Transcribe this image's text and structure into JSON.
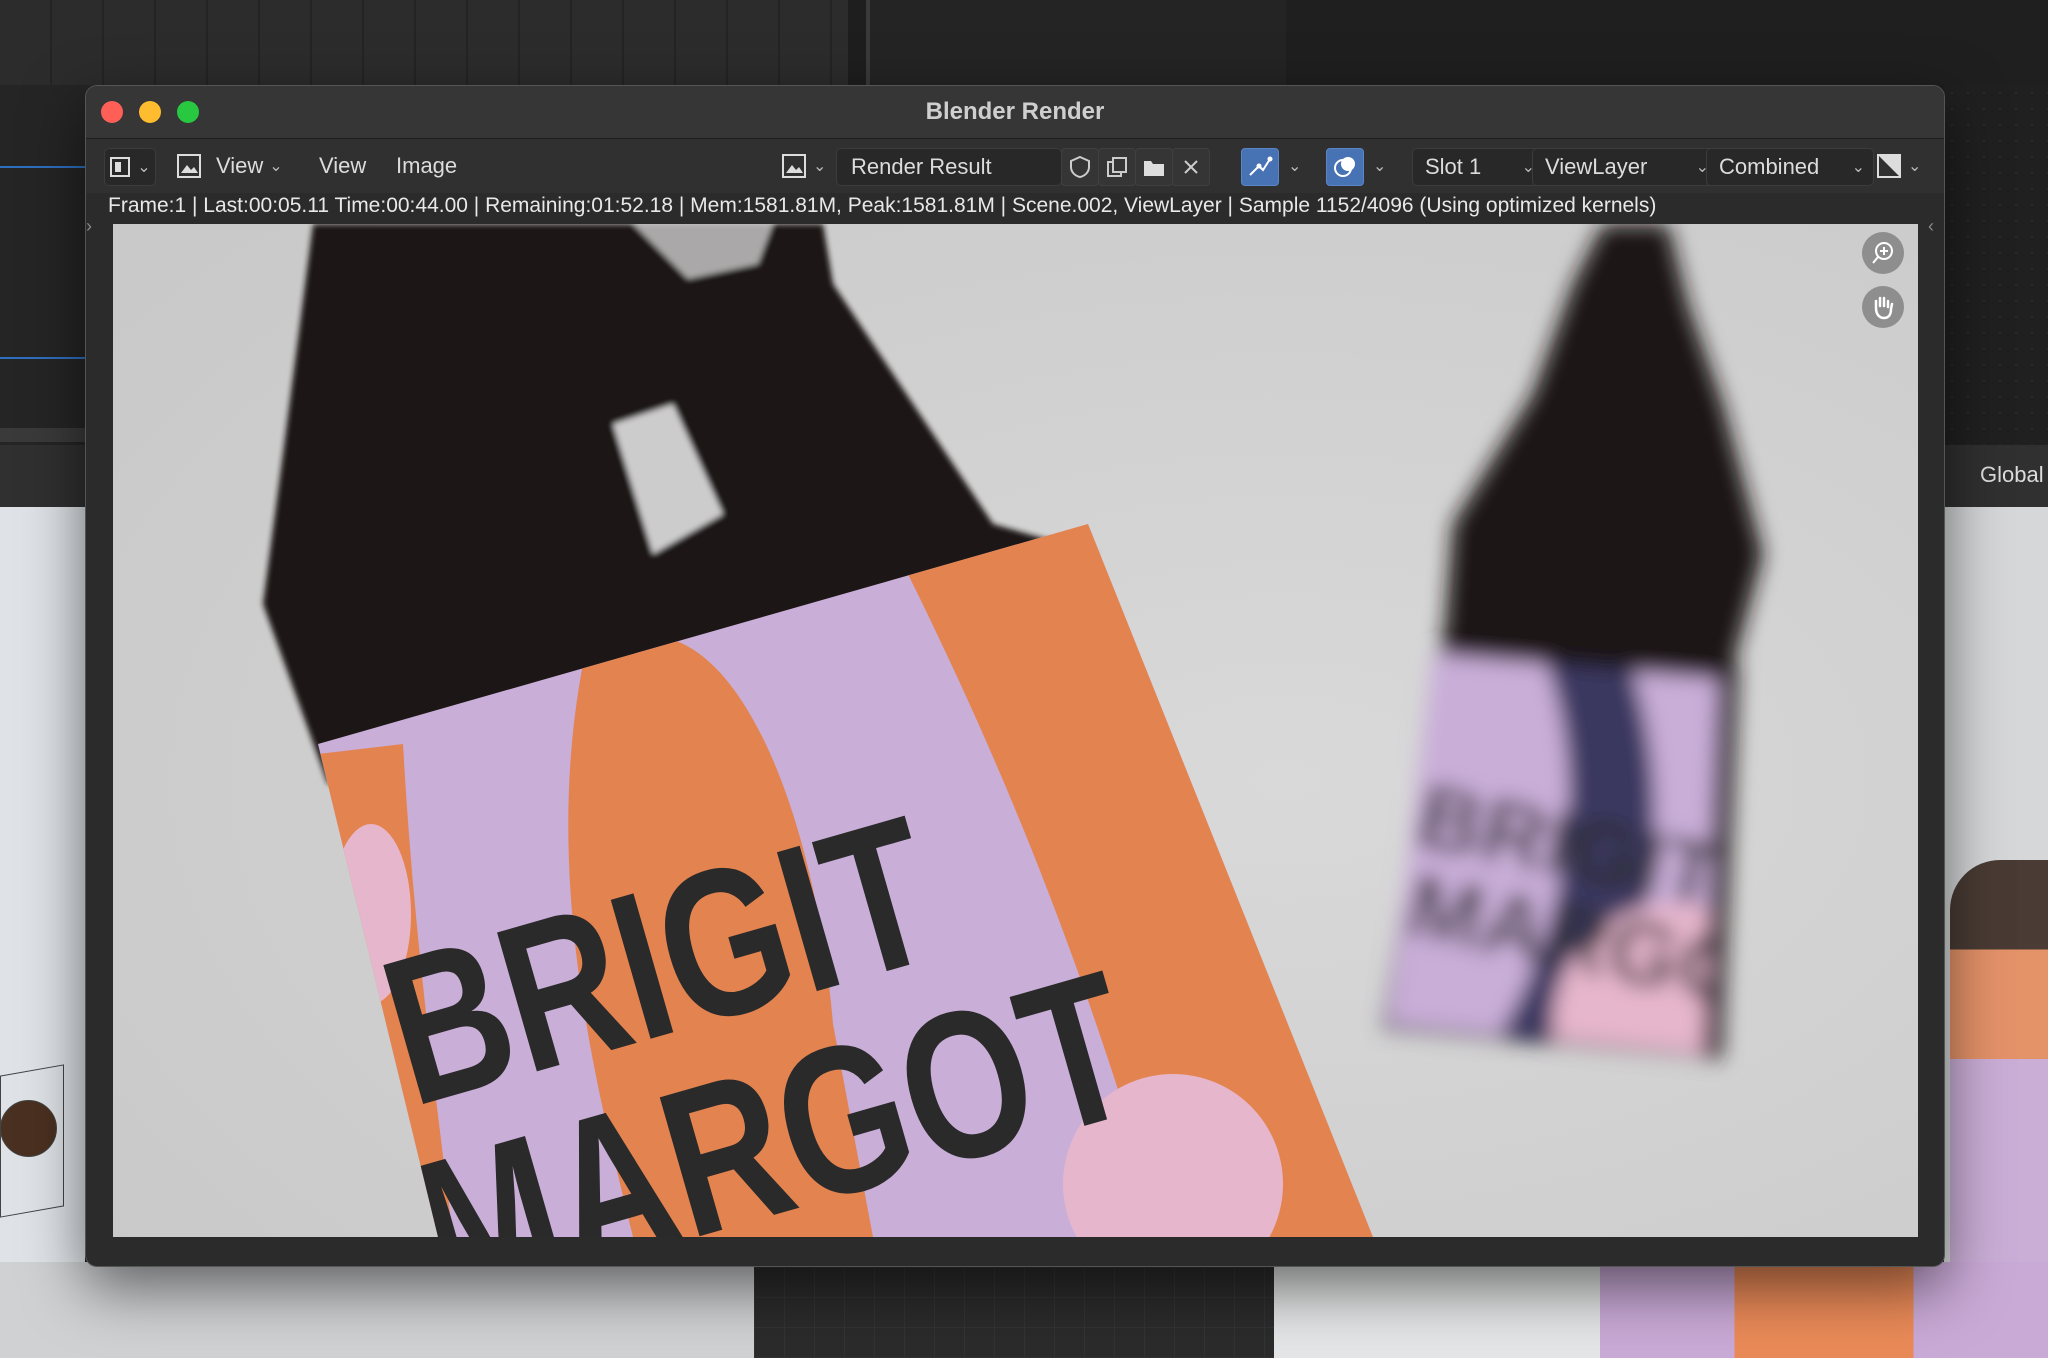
{
  "window": {
    "title": "Blender Render"
  },
  "toolbar": {
    "view_menu_selected": "View",
    "menu_view": "View",
    "menu_image": "Image",
    "image_name": "Render Result",
    "slot": "Slot 1",
    "view_layer": "ViewLayer",
    "pass": "Combined"
  },
  "status": {
    "text": "Frame:1 | Last:00:05.11 Time:00:44.00 | Remaining:01:52.18 | Mem:1581.81M, Peak:1581.81M | Scene.002, ViewLayer | Sample 1152/4096 (Using optimized kernels)"
  },
  "background": {
    "transform_orientation": "Global"
  },
  "render": {
    "label_line1": "BRIGIT",
    "label_line2": "MARGOT",
    "colors": {
      "background": "#d3d3d3",
      "bottle_glass": "#1a1212",
      "label_lilac": "#c9aed8",
      "label_orange": "#e3834f",
      "label_pink": "#e6b6cc",
      "label_navy": "#3b3760",
      "text_dark": "#2a2a2a"
    }
  },
  "icons": {
    "editor_type": "image-editor-icon",
    "zoom": "zoom-in-icon",
    "pan": "hand-icon"
  }
}
